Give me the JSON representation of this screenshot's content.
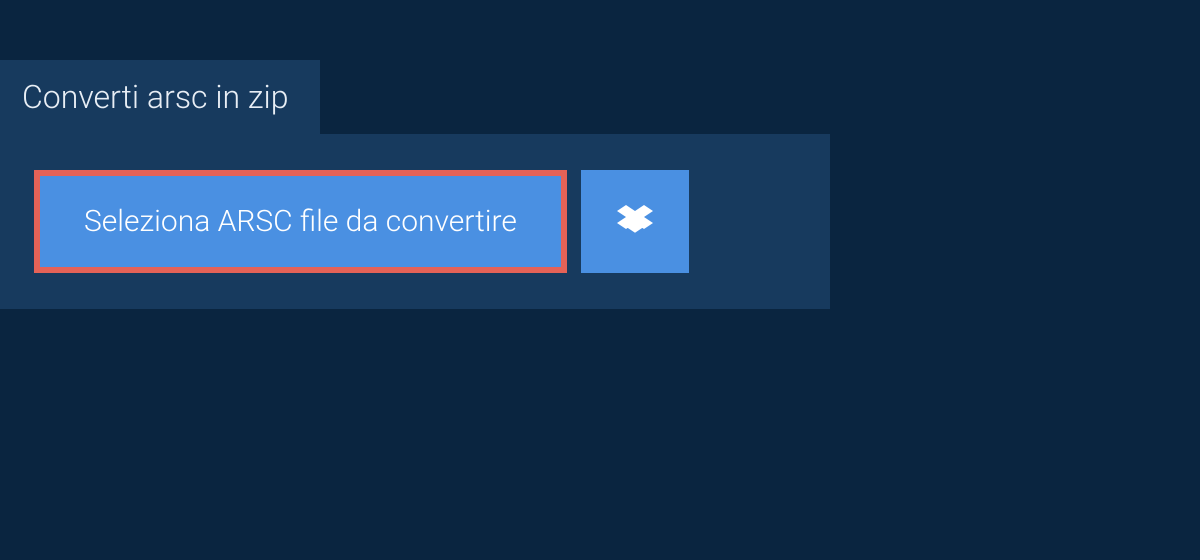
{
  "tab": {
    "label": "Converti arsc in zip"
  },
  "buttons": {
    "select_label": "Seleziona ARSC file da convertire"
  }
}
